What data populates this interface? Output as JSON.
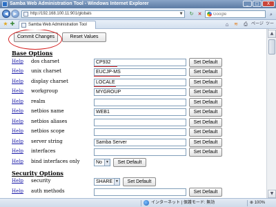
{
  "window": {
    "title": "Samba Web Administration Tool - Windows Internet Explorer",
    "minimize": "_",
    "maximize": "□",
    "close": "X"
  },
  "address_bar": {
    "back": "◀",
    "forward": "▶",
    "url": "http://192.168.100.11:901/globals",
    "dropdown": "▼",
    "refresh": "↻",
    "stop": "×",
    "search_placeholder": "Google",
    "search": "⌕"
  },
  "tab_bar": {
    "tab_title": "Samba Web Administration Tool",
    "home": "⌂",
    "feeds": "≋",
    "print": "⎙",
    "page_menu": "ページ",
    "tools_menu": "ツール"
  },
  "toolbar": {
    "commit": "Commit Changes",
    "reset": "Reset Values"
  },
  "sections": {
    "base": "Base Options",
    "security": "Security Options"
  },
  "help_label": "Help",
  "set_default_label": "Set Default",
  "base_options": [
    {
      "label": "dos charset",
      "value": "CP932"
    },
    {
      "label": "unix charset",
      "value": "EUCJP-MS"
    },
    {
      "label": "display charset",
      "value": "LOCALE"
    },
    {
      "label": "workgroup",
      "value": "MYGROUP"
    },
    {
      "label": "realm",
      "value": ""
    },
    {
      "label": "netbios name",
      "value": "WEB1"
    },
    {
      "label": "netbios aliases",
      "value": ""
    },
    {
      "label": "netbios scope",
      "value": ""
    },
    {
      "label": "server string",
      "value": "Samba Server"
    },
    {
      "label": "interfaces",
      "value": ""
    }
  ],
  "bind_interfaces": {
    "label": "bind interfaces only",
    "value": "No"
  },
  "security_options": {
    "security": {
      "label": "security",
      "value": "SHARE"
    },
    "auth_methods": {
      "label": "auth methods",
      "value": ""
    }
  },
  "status_bar": {
    "zone": "インターネット | 保護モード: 無効",
    "zoom": "⊕ 100%"
  },
  "scrollbar": {
    "up": "▲",
    "down": "▼"
  },
  "colors": {
    "annotation": "#d42020",
    "link": "#1a1aa8"
  }
}
